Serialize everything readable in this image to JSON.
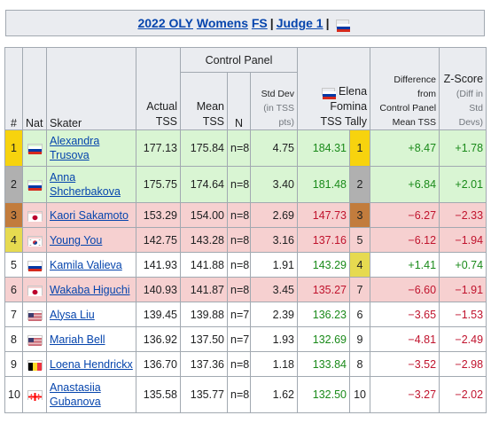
{
  "title": {
    "part1": "2022 OLY",
    "part2": "Womens",
    "part3": "FS",
    "sep1": "|",
    "part4": "Judge 1",
    "sep2": "|"
  },
  "headers": {
    "control_panel": "Control Panel",
    "rank": "#",
    "nat": "Nat",
    "skater": "Skater",
    "actual_tss_1": "Actual",
    "actual_tss_2": "TSS",
    "mean_tss_1": "Mean",
    "mean_tss_2": "TSS",
    "n": "N",
    "std_dev_1": "Std Dev",
    "std_dev_2": "(in TSS",
    "std_dev_3": "pts)",
    "judge_1": "Elena",
    "judge_2": "Fomina",
    "judge_3": "TSS Tally",
    "diff_1": "Difference",
    "diff_2": "from",
    "diff_3": "Control Panel",
    "diff_4": "Mean TSS",
    "z_1": "Z-Score",
    "z_2": "(Diff in",
    "z_3": "Std",
    "z_4": "Devs)"
  },
  "rows": [
    {
      "rank": "1",
      "nat": "RUS",
      "skater": [
        "Alexandra",
        "Trusova"
      ],
      "actual": "177.13",
      "mean": "175.84",
      "n": "n=8",
      "sd": "4.75",
      "tss": "184.31",
      "tally": "1",
      "diff": "+8.47",
      "z": "+1.78"
    },
    {
      "rank": "2",
      "nat": "RUS",
      "skater": [
        "Anna",
        "Shcherbakova"
      ],
      "actual": "175.75",
      "mean": "174.64",
      "n": "n=8",
      "sd": "3.40",
      "tss": "181.48",
      "tally": "2",
      "diff": "+6.84",
      "z": "+2.01"
    },
    {
      "rank": "3",
      "nat": "JPN",
      "skater": [
        "Kaori Sakamoto"
      ],
      "actual": "153.29",
      "mean": "154.00",
      "n": "n=8",
      "sd": "2.69",
      "tss": "147.73",
      "tally": "3",
      "diff": "−6.27",
      "z": "−2.33"
    },
    {
      "rank": "4",
      "nat": "KOR",
      "skater": [
        "Young You"
      ],
      "actual": "142.75",
      "mean": "143.28",
      "n": "n=8",
      "sd": "3.16",
      "tss": "137.16",
      "tally": "5",
      "diff": "−6.12",
      "z": "−1.94"
    },
    {
      "rank": "5",
      "nat": "RUS",
      "skater": [
        "Kamila Valieva"
      ],
      "actual": "141.93",
      "mean": "141.88",
      "n": "n=8",
      "sd": "1.91",
      "tss": "143.29",
      "tally": "4",
      "diff": "+1.41",
      "z": "+0.74"
    },
    {
      "rank": "6",
      "nat": "JPN",
      "skater": [
        "Wakaba Higuchi"
      ],
      "actual": "140.93",
      "mean": "141.87",
      "n": "n=8",
      "sd": "3.45",
      "tss": "135.27",
      "tally": "7",
      "diff": "−6.60",
      "z": "−1.91"
    },
    {
      "rank": "7",
      "nat": "USA",
      "skater": [
        "Alysa Liu"
      ],
      "actual": "139.45",
      "mean": "139.88",
      "n": "n=7",
      "sd": "2.39",
      "tss": "136.23",
      "tally": "6",
      "diff": "−3.65",
      "z": "−1.53"
    },
    {
      "rank": "8",
      "nat": "USA",
      "skater": [
        "Mariah Bell"
      ],
      "actual": "136.92",
      "mean": "137.50",
      "n": "n=7",
      "sd": "1.93",
      "tss": "132.69",
      "tally": "9",
      "diff": "−4.81",
      "z": "−2.49"
    },
    {
      "rank": "9",
      "nat": "BEL",
      "skater": [
        "Loena Hendrickx"
      ],
      "actual": "136.70",
      "mean": "137.36",
      "n": "n=8",
      "sd": "1.18",
      "tss": "133.84",
      "tally": "8",
      "diff": "−3.52",
      "z": "−2.98"
    },
    {
      "rank": "10",
      "nat": "GEO",
      "skater": [
        "Anastasiia",
        "Gubanova"
      ],
      "actual": "135.58",
      "mean": "135.77",
      "n": "n=8",
      "sd": "1.62",
      "tss": "132.50",
      "tally": "10",
      "diff": "−3.27",
      "z": "−2.02"
    }
  ],
  "colors": {
    "green_row": "#d9f5d3",
    "red_row": "#f6d0d0",
    "gold": "#f7d30e",
    "silver": "#b0b0b0",
    "bronze": "#c27c3d",
    "positive": "#1a8a1a",
    "negative": "#c0132d",
    "link": "#0645ad"
  }
}
